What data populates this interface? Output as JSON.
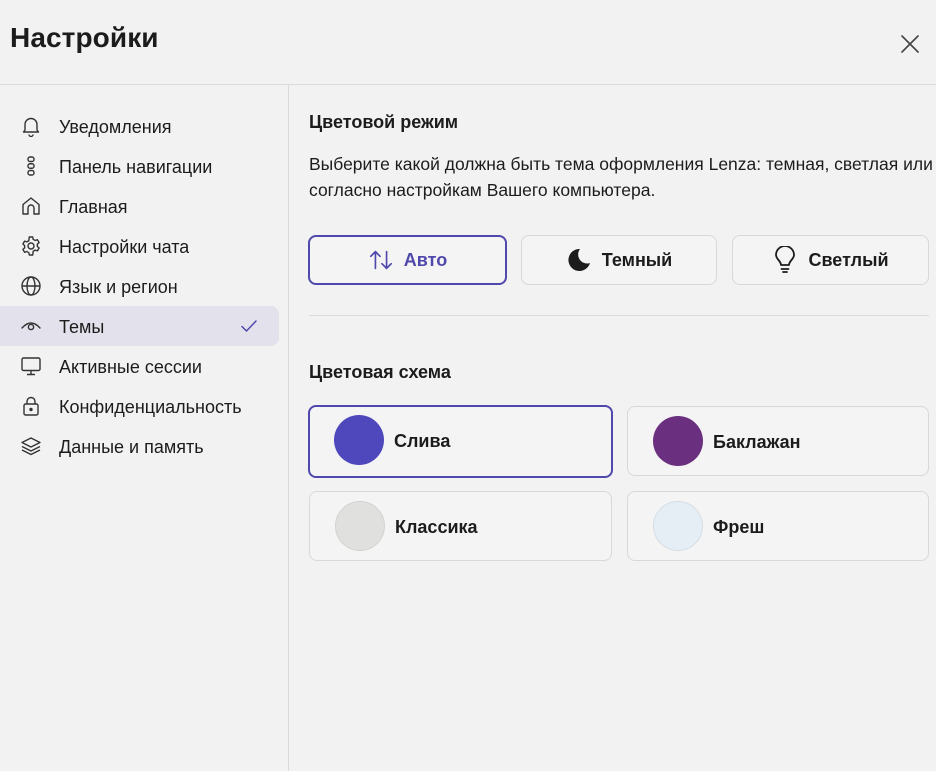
{
  "header": {
    "title": "Настройки",
    "close_icon": "close-icon"
  },
  "sidebar": {
    "items": [
      {
        "label": "Уведомления",
        "icon": "bell-icon",
        "active": false
      },
      {
        "label": "Панель навигации",
        "icon": "navigation-panel-icon",
        "active": false
      },
      {
        "label": "Главная",
        "icon": "home-icon",
        "active": false
      },
      {
        "label": "Настройки чата",
        "icon": "gear-icon",
        "active": false
      },
      {
        "label": "Язык и регион",
        "icon": "globe-icon",
        "active": false
      },
      {
        "label": "Темы",
        "icon": "eye-icon",
        "active": true,
        "check_icon": "checkmark-icon"
      },
      {
        "label": "Активные сессии",
        "icon": "monitor-icon",
        "active": false
      },
      {
        "label": "Конфиденциальность",
        "icon": "lock-icon",
        "active": false
      },
      {
        "label": "Данные и память",
        "icon": "layers-icon",
        "active": false
      }
    ]
  },
  "main": {
    "color_mode": {
      "title": "Цветовой режим",
      "description": "Выберите какой должна быть тема оформления Lenza: темная, светлая или согласно настройкам Вашего компьютера.",
      "options": [
        {
          "label": "Авто",
          "icon": "auto-sort-arrows-icon",
          "selected": true
        },
        {
          "label": "Темный",
          "icon": "moon-icon",
          "selected": false
        },
        {
          "label": "Светлый",
          "icon": "lightbulb-icon",
          "selected": false
        }
      ]
    },
    "color_scheme": {
      "title": "Цветовая схема",
      "options": [
        {
          "label": "Слива",
          "color": "#4f48bd",
          "selected": true
        },
        {
          "label": "Баклажан",
          "color": "#6b2f80",
          "selected": false
        },
        {
          "label": "Классика",
          "color": "#e0e0de",
          "selected": false
        },
        {
          "label": "Фреш",
          "color": "#e6eef5",
          "selected": false
        }
      ]
    }
  },
  "colors": {
    "accent": "#4f48ad",
    "background": "#f2f2f2",
    "active_nav": "#e3e2ec",
    "border": "#d8d8d8"
  }
}
